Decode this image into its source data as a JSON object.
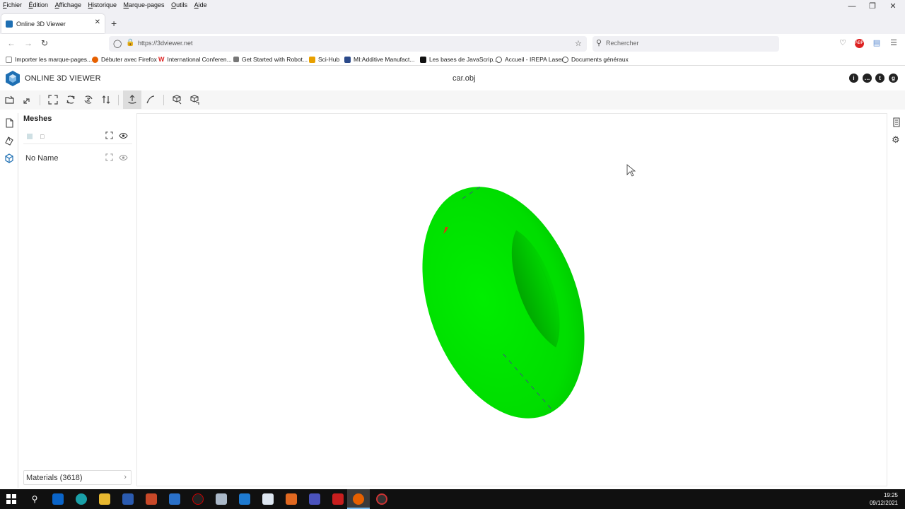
{
  "browser": {
    "menu": [
      "Fichier",
      "Édition",
      "Affichage",
      "Historique",
      "Marque-pages",
      "Outils",
      "Aide"
    ],
    "tab_title": "Online 3D Viewer",
    "new_tab_icon": "plus-icon",
    "url": "https://3dviewer.net",
    "search_placeholder": "Rechercher",
    "bookmarks": [
      {
        "label": "Importer les marque-pages...",
        "icon": "import-icon",
        "color": "#888888"
      },
      {
        "label": "Débuter avec Firefox",
        "icon": "firefox-icon",
        "color": "#e66000"
      },
      {
        "label": "International Conferen...",
        "icon": "w-logo-icon",
        "color": "#d22222"
      },
      {
        "label": "Get Started with Robot...",
        "icon": "robot-icon",
        "color": "#555555"
      },
      {
        "label": "Sci-Hub",
        "icon": "scihub-icon",
        "color": "#e8a000"
      },
      {
        "label": "MI:Additive Manufact...",
        "icon": "mi-icon",
        "color": "#2b4a8a"
      },
      {
        "label": "Les bases de JavaScrip...",
        "icon": "mdn-icon",
        "color": "#111111"
      },
      {
        "label": "Accueil - IREPA Laser",
        "icon": "globe-icon",
        "color": "#555555"
      },
      {
        "label": "Documents généraux",
        "icon": "globe-icon",
        "color": "#555555"
      }
    ]
  },
  "app": {
    "title": "ONLINE 3D VIEWER",
    "filename": "car.obj",
    "panel_title": "Meshes",
    "mesh_name": "No Name",
    "materials_label": "Materials (3618)",
    "model_color": "#00e000",
    "accent_color": "#1e6fb3"
  },
  "taskbar": {
    "time": "19:25",
    "date": "09/12/2021"
  }
}
